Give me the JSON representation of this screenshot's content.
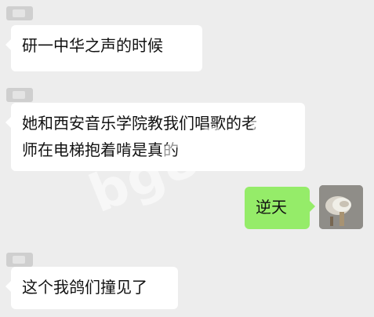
{
  "messages": [
    {
      "side": "left",
      "lines": [
        "研一中华之声的时候"
      ]
    },
    {
      "side": "left",
      "lines": [
        "她和西安音乐学院教我们唱歌的老",
        "师在电梯抱着啃是真的"
      ]
    },
    {
      "side": "right",
      "lines": [
        "逆天"
      ]
    },
    {
      "side": "left",
      "lines": [
        "这个我鸽们撞见了"
      ]
    }
  ],
  "watermark": {
    "text": "bg88.n"
  },
  "colors": {
    "background": "#ededed",
    "left_bubble": "#ffffff",
    "right_bubble": "#95ec69"
  },
  "icons": {
    "right_avatar": "user-avatar-icon",
    "left_avatar_placeholder": "avatar-placeholder-icon"
  }
}
